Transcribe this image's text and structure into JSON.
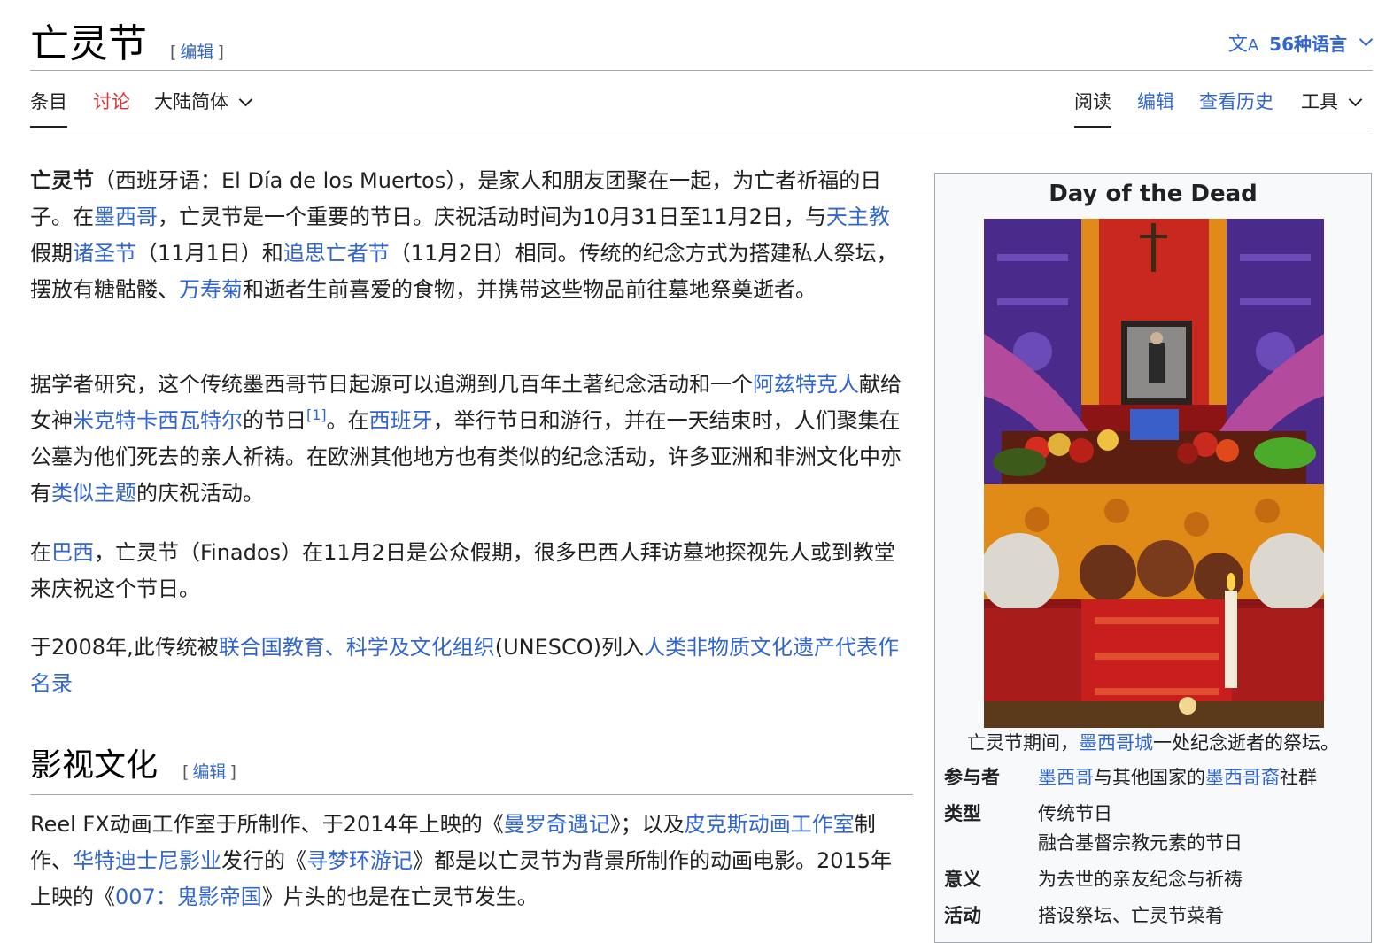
{
  "header": {
    "title": "亡灵节",
    "edit_open": "[",
    "edit_label": "编辑",
    "edit_close": "]",
    "languages_label": "56种语言",
    "languages_icon": "translate-icon"
  },
  "tabs": {
    "article": "条目",
    "talk": "讨论",
    "variant": "大陆简体",
    "read": "阅读",
    "edit": "编辑",
    "history": "查看历史",
    "tools": "工具"
  },
  "paragraphs": {
    "p1": {
      "bold": "亡灵节",
      "t1": "（西班牙语：El Día de los Muertos），是家人和朋友团聚在一起，为亡者祈福的日子。在",
      "l1": "墨西哥",
      "t2": "，亡灵节是一个重要的节日。庆祝活动时间为10月31日至11月2日，与",
      "l2": "天主教",
      "t3": "假期",
      "l3": "诸圣节",
      "t4": "（11月1日）和",
      "l4": "追思亡者节",
      "t5": "（11月2日）相同。传统的纪念方式为搭建私人祭坛，摆放有糖骷髅、",
      "l5": "万寿菊",
      "t6": "和逝者生前喜爱的食物，并携带这些物品前往墓地祭奠逝者。"
    },
    "p2": {
      "t1": "据学者研究，这个传统墨西哥节日起源可以追溯到几百年土著纪念活动和一个",
      "l1": "阿兹特克人",
      "t2": "献给女神",
      "l2": "米克特卡西瓦特尔",
      "t3": "的节日",
      "ref": "[1]",
      "t4": "。在",
      "l3": "西班牙",
      "t5": "，举行节日和游行，并在一天结束时，人们聚集在公墓为他们死去的亲人祈祷。在欧洲其他地方也有类似的纪念活动，许多亚洲和非洲文化中亦有",
      "l4": "类似主题",
      "t6": "的庆祝活动。"
    },
    "p3": {
      "t1": "在",
      "l1": "巴西",
      "t2": "，亡灵节（Finados）在11月2日是公众假期，很多巴西人拜访墓地探视先人或到教堂来庆祝这个节日。"
    },
    "p4": {
      "t1": "于2008年,此传统被",
      "l1": "联合国教育、科学及文化组织",
      "t2": "(UNESCO)列入",
      "l2": "人类非物质文化遗产代表作名录"
    }
  },
  "section": {
    "heading": "影视文化",
    "edit_open": "[",
    "edit_label": "编辑",
    "edit_close": "]",
    "p": {
      "t1": "Reel FX动画工作室于所制作、于2014年上映的《",
      "l1": "曼罗奇遇记",
      "t2": "》；以及",
      "l2": "皮克斯动画工作室",
      "t3": "制作、",
      "l3": "华特迪士尼影业",
      "t4": "发行的《",
      "l4": "寻梦环游记",
      "t5": "》都是以亡灵节为背景所制作的动画电影。2015年上映的《",
      "l5": "007：鬼影帝国",
      "t6": "》片头的也是在亡灵节发生。"
    }
  },
  "infobox": {
    "title": "Day of the Dead",
    "caption_t1": "亡灵节期间，",
    "caption_link": "墨西哥城",
    "caption_t2": "一处纪念逝者的祭坛。",
    "rows": {
      "participants": {
        "label": "参与者",
        "l1": "墨西哥",
        "t1": "与其他国家的",
        "l2": "墨西哥裔",
        "t2": "社群"
      },
      "type": {
        "label": "类型",
        "v1": "传统节日",
        "v2": "融合基督宗教元素的节日"
      },
      "significance": {
        "label": "意义",
        "v1": "为去世的亲友纪念与祈祷"
      },
      "activities": {
        "label": "活动",
        "v1": "搭设祭坛、亡灵节菜肴"
      }
    }
  },
  "colors": {
    "link": "#3366cc",
    "talk_link": "#d33333",
    "text": "#202122",
    "border": "#a2a9b1"
  }
}
